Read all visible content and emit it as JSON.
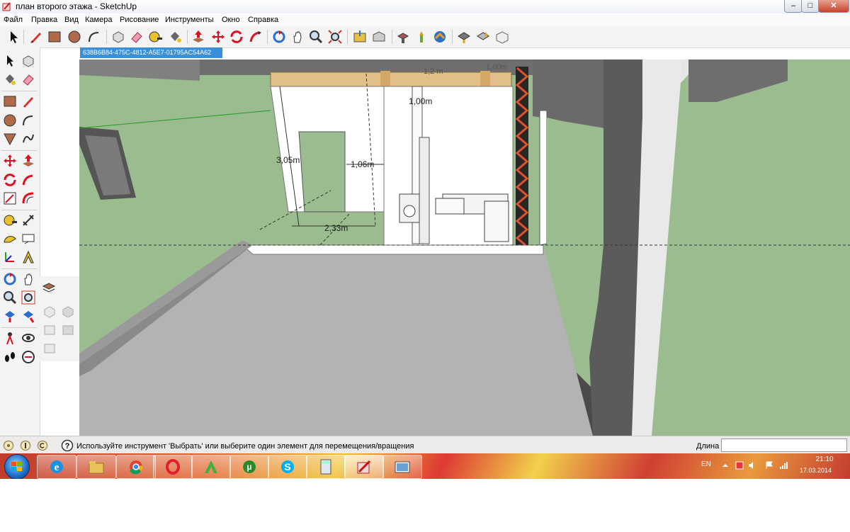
{
  "window": {
    "title": "план второго этажа - SketchUp",
    "controls": {
      "minimize": "–",
      "maximize": "□",
      "close": "✕"
    }
  },
  "menu": {
    "items": [
      {
        "label": "Файл"
      },
      {
        "label": "Правка"
      },
      {
        "label": "Вид"
      },
      {
        "label": "Камера"
      },
      {
        "label": "Рисование"
      },
      {
        "label": "Инструменты"
      },
      {
        "label": "Окно"
      },
      {
        "label": "Справка"
      }
    ]
  },
  "toolbar": {
    "tools": [
      "select-icon",
      "pencil-icon",
      "rectangle-icon",
      "circle-icon",
      "arc-icon",
      "make-component-icon",
      "eraser-icon",
      "tape-measure-icon",
      "paint-bucket-icon",
      "push-pull-icon",
      "move-icon",
      "rotate-icon",
      "follow-me-icon",
      "orbit-icon",
      "pan-icon",
      "zoom-icon",
      "zoom-extents-icon",
      "get-models-icon",
      "share-model-icon",
      "components-icon",
      "warehouse-icon",
      "photo-textures-icon",
      "preview-icon",
      "upload-icon",
      "front-view-icon"
    ]
  },
  "palette": {
    "tools": [
      "select-icon",
      "make-component-icon",
      "paint-bucket-icon",
      "eraser-icon",
      "rectangle-icon",
      "line-icon",
      "circle-icon",
      "arc-icon",
      "polygon-icon",
      "freehand-icon",
      "move-icon",
      "push-pull-icon",
      "rotate-icon",
      "follow-me-icon",
      "scale-icon",
      "offset-icon",
      "tape-measure-icon",
      "dimension-icon",
      "protractor-icon",
      "text-icon",
      "axes-icon",
      "3d-text-icon",
      "orbit-icon",
      "pan-icon",
      "zoom-icon",
      "zoom-window-icon",
      "previous-view-icon",
      "next-view-icon",
      "position-camera-icon",
      "look-around-icon",
      "walk-icon",
      "section-plane-icon"
    ]
  },
  "entity_id": "638B6B84-475C-4812-A5E7-01795AC54A62",
  "scene": {
    "dimensions": {
      "height": "3,05m",
      "door_width": "1,06m",
      "length": "2,33m",
      "top_1": "1,00m",
      "top_2": "1,2 m",
      "top_3": "1,00m"
    },
    "colors": {
      "sky": "#9bbc8f",
      "floor": "#b3b3b3",
      "wall": "#ffffff",
      "beam": "#e2bf88",
      "dark_wall": "#5a5a5a"
    }
  },
  "statusbar": {
    "hint": "Используйте инструмент 'Выбрать' или выберите один элемент для перемещения/вращения",
    "distance_label": "Длина",
    "distance_value": ""
  },
  "taskbar": {
    "apps": [
      "ie-icon",
      "explorer-icon",
      "chrome-icon",
      "opera-icon",
      "green-a-icon",
      "utorrent-icon",
      "skype-icon",
      "calculator-icon",
      "sketchup-icon",
      "photo-viewer-icon"
    ],
    "language": "EN",
    "time": "21:10",
    "date": "17.03.2014"
  }
}
